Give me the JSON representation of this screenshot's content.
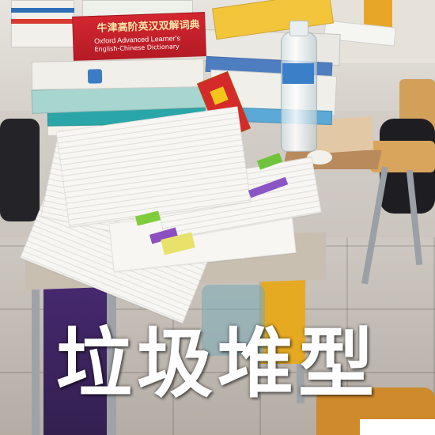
{
  "caption": "垃圾堆型",
  "dictionary": {
    "chinese_title": "牛津高阶英汉双解词典",
    "english_title_line1": "Oxford Advanced Learner's",
    "english_title_line2": "English-Chinese Dictionary"
  },
  "colors": {
    "dictionary_red": "#d32630",
    "caption_text": "#ffffff",
    "purple_bag": "#4a2a76",
    "chair_orange": "#cf8a2c"
  }
}
